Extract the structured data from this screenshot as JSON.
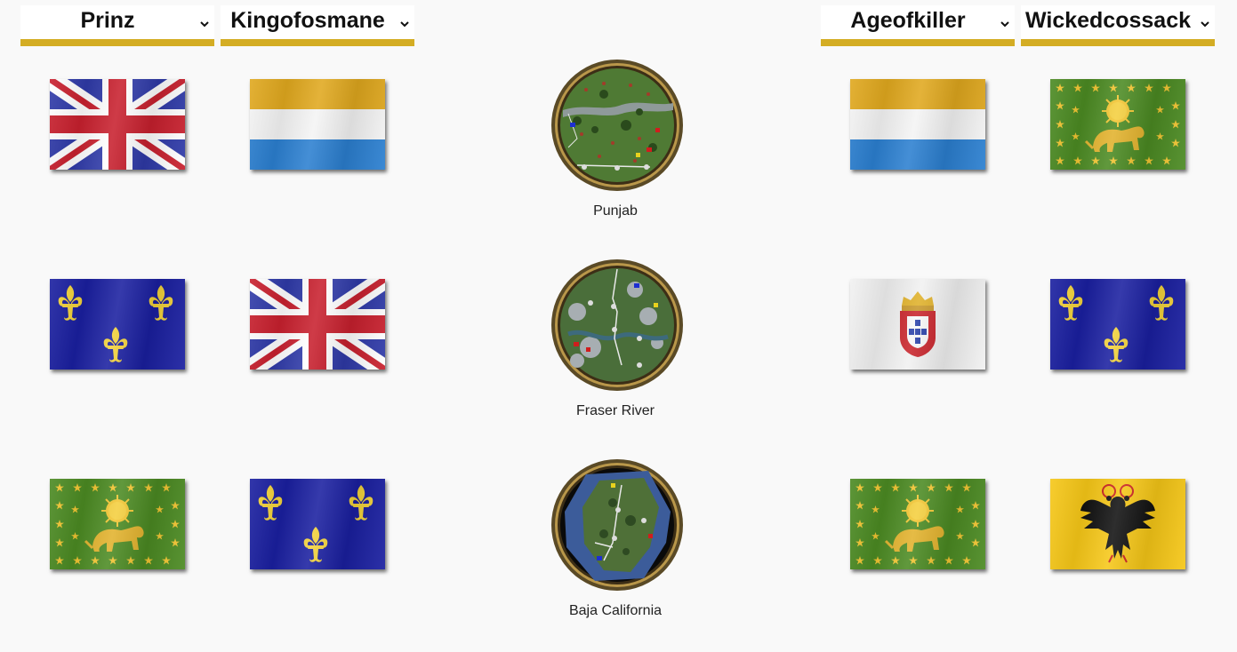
{
  "players": {
    "team1": [
      {
        "name": "Prinz"
      },
      {
        "name": "Kingofosmane"
      }
    ],
    "team2": [
      {
        "name": "Ageofkiller"
      },
      {
        "name": "Wickedcossack"
      }
    ]
  },
  "games": [
    {
      "map": "Punjab",
      "flags": [
        "british-flag",
        "dutch-flag",
        "dutch-flag",
        "persian-lion-flag"
      ]
    },
    {
      "map": "Fraser River",
      "flags": [
        "french-flag",
        "british-flag",
        "portuguese-flag",
        "french-flag"
      ]
    },
    {
      "map": "Baja California",
      "flags": [
        "persian-lion-flag",
        "french-flag",
        "persian-lion-flag",
        "german-eagle-flag"
      ]
    }
  ],
  "colors": {
    "accent": "#d4ad24",
    "background": "#f9f9f9"
  }
}
